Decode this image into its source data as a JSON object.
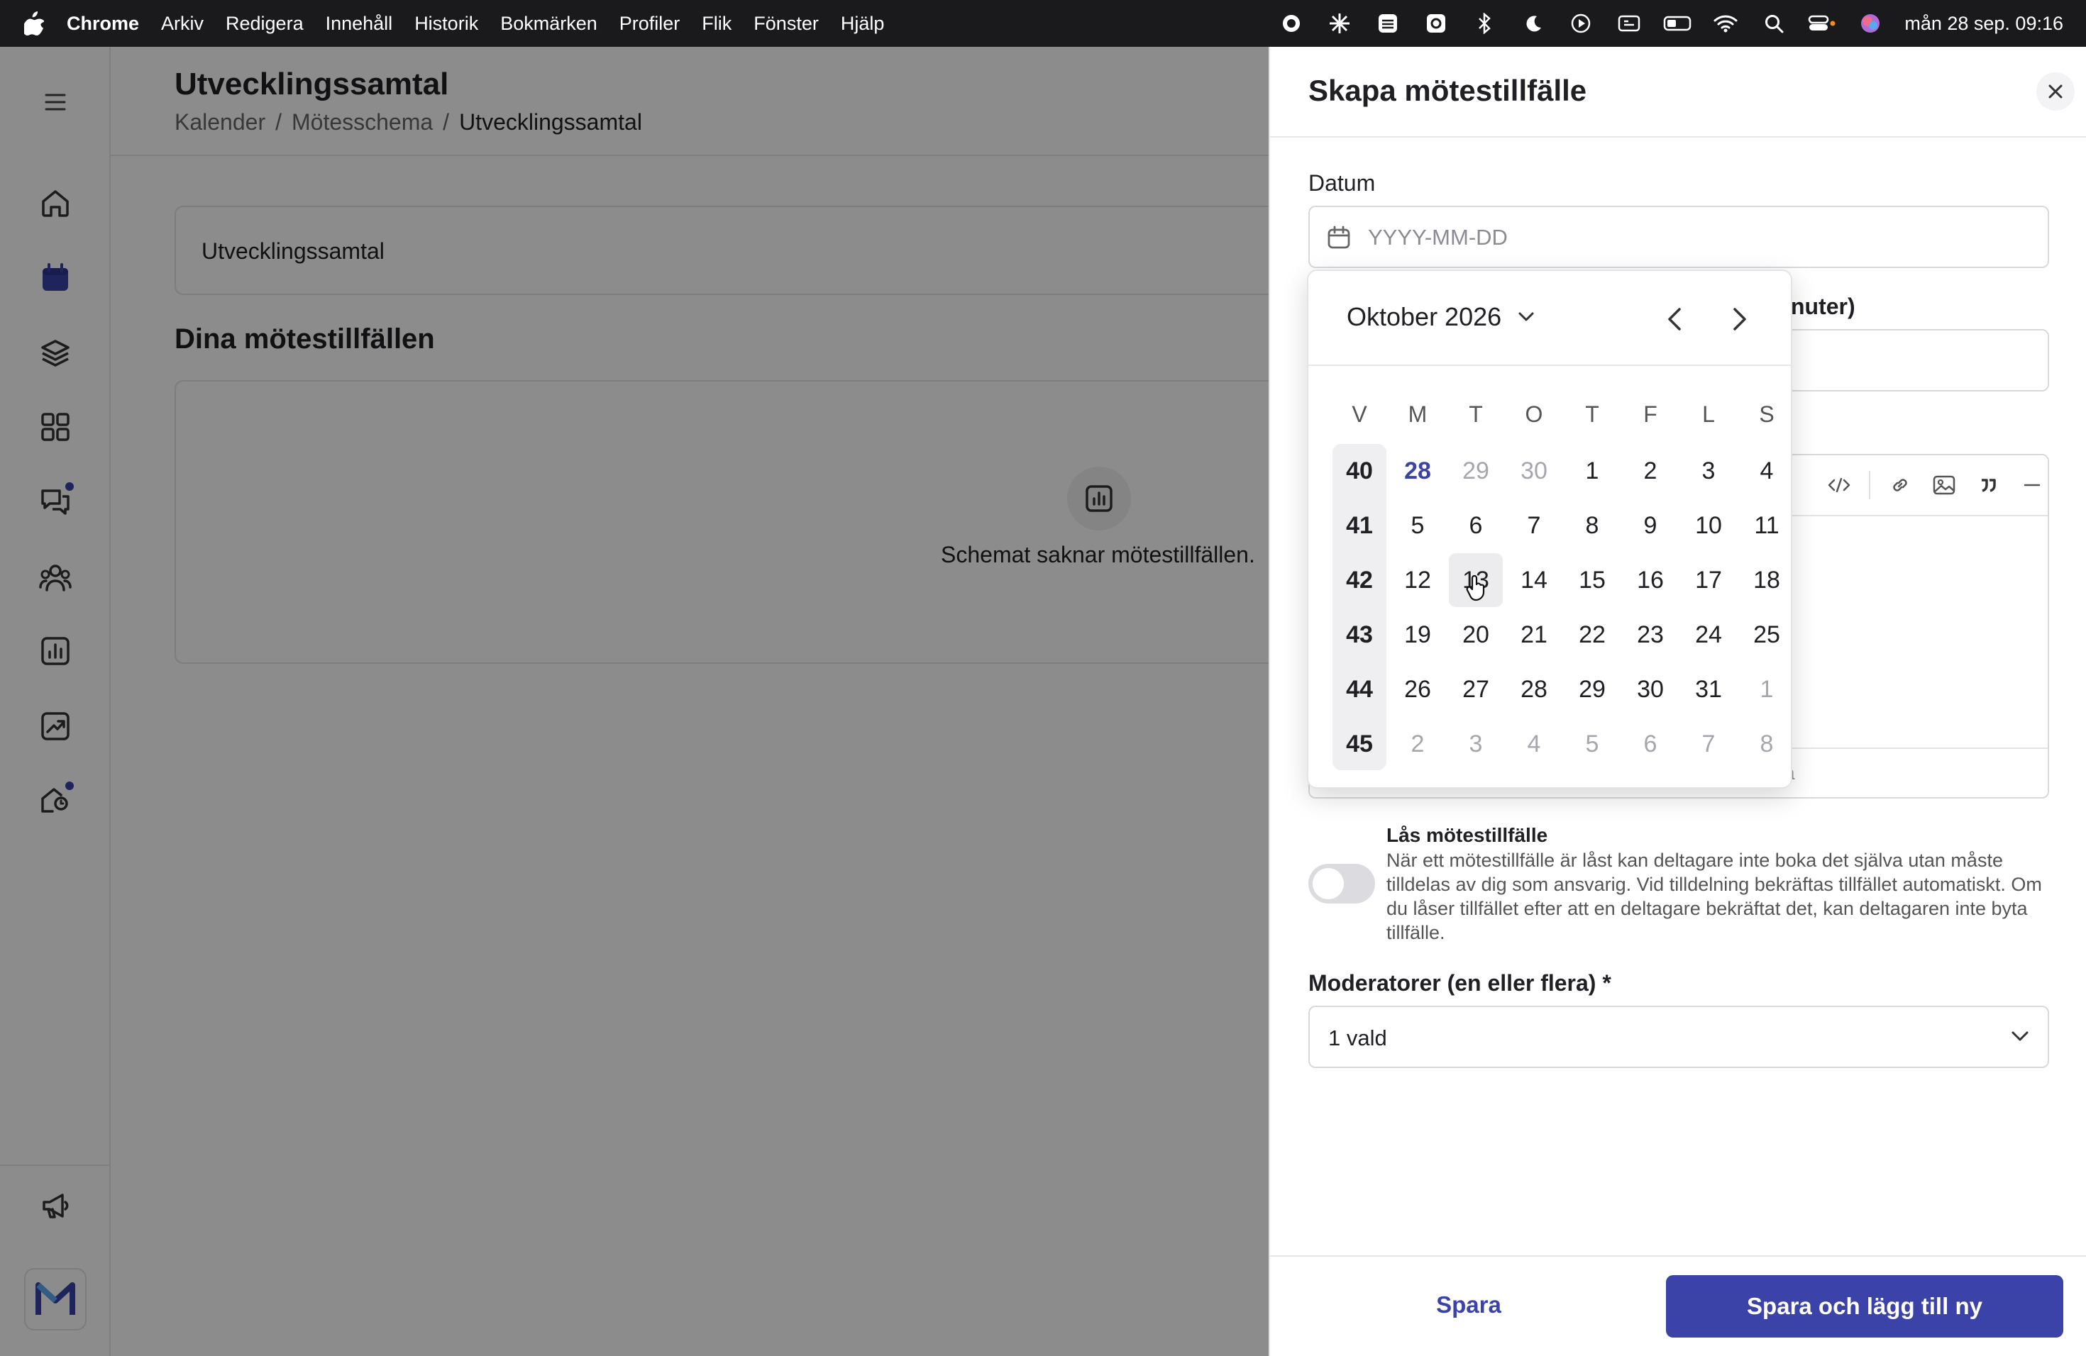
{
  "menubar": {
    "app": "Chrome",
    "items": [
      "Arkiv",
      "Redigera",
      "Innehåll",
      "Historik",
      "Bokmärken",
      "Profiler",
      "Flik",
      "Fönster",
      "Hjälp"
    ],
    "clock": "mån 28 sep. 09:16"
  },
  "page": {
    "title": "Utvecklingssamtal",
    "breadcrumb": [
      "Kalender",
      "Mötesschema",
      "Utvecklingssamtal"
    ],
    "schedule_name": "Utvecklingssamtal",
    "sessions_title": "Dina mötestillfällen",
    "empty_text": "Schemat saknar mötestillfällen."
  },
  "drawer": {
    "title": "Skapa mötestillfälle",
    "date_label": "Datum",
    "date_placeholder": "YYYY-MM-DD",
    "duration_label_partial": "nuter)",
    "editor_footer_partial": "a",
    "lock_title": "Lås mötestillfälle",
    "lock_description": "När ett mötestillfälle är låst kan deltagare inte boka det själva utan måste tilldelas av dig som ansvarig. Vid tilldelning bekräftas tillfället automatiskt. Om du låser tillfället efter att en deltagare bekräftat det, kan deltagaren inte byta tillfälle.",
    "lock_enabled": false,
    "moderators_label": "Moderatorer (en eller flera) *",
    "moderators_value": "1 vald",
    "save_label": "Spara",
    "save_new_label": "Spara och lägg till ny"
  },
  "datepicker": {
    "month_label": "Oktober 2026",
    "weekday_headers": [
      "V",
      "M",
      "T",
      "O",
      "T",
      "F",
      "L",
      "S"
    ],
    "weeks": [
      {
        "week": "40",
        "days": [
          "28",
          "29",
          "30",
          "1",
          "2",
          "3",
          "4"
        ],
        "muted": [
          false,
          true,
          true,
          false,
          false,
          false,
          false
        ]
      },
      {
        "week": "41",
        "days": [
          "5",
          "6",
          "7",
          "8",
          "9",
          "10",
          "11"
        ],
        "muted": [
          false,
          false,
          false,
          false,
          false,
          false,
          false
        ]
      },
      {
        "week": "42",
        "days": [
          "12",
          "13",
          "14",
          "15",
          "16",
          "17",
          "18"
        ],
        "muted": [
          false,
          false,
          false,
          false,
          false,
          false,
          false
        ]
      },
      {
        "week": "43",
        "days": [
          "19",
          "20",
          "21",
          "22",
          "23",
          "24",
          "25"
        ],
        "muted": [
          false,
          false,
          false,
          false,
          false,
          false,
          false
        ]
      },
      {
        "week": "44",
        "days": [
          "26",
          "27",
          "28",
          "29",
          "30",
          "31",
          "1"
        ],
        "muted": [
          false,
          false,
          false,
          false,
          false,
          false,
          true
        ]
      },
      {
        "week": "45",
        "days": [
          "2",
          "3",
          "4",
          "5",
          "6",
          "7",
          "8"
        ],
        "muted": [
          true,
          true,
          true,
          true,
          true,
          true,
          true
        ]
      }
    ],
    "today": "28",
    "hovered": "13"
  },
  "colors": {
    "accent": "#3b43a8",
    "overlay": "rgba(0,0,0,0.45)"
  },
  "icons": {
    "sidebar": [
      "menu-icon",
      "home-icon",
      "calendar-icon",
      "layers-icon",
      "grid-icon",
      "chat-icon",
      "group-icon",
      "bar-chart-icon",
      "trend-chart-icon",
      "home-search-icon",
      "megaphone-icon",
      "logo-icon"
    ]
  }
}
